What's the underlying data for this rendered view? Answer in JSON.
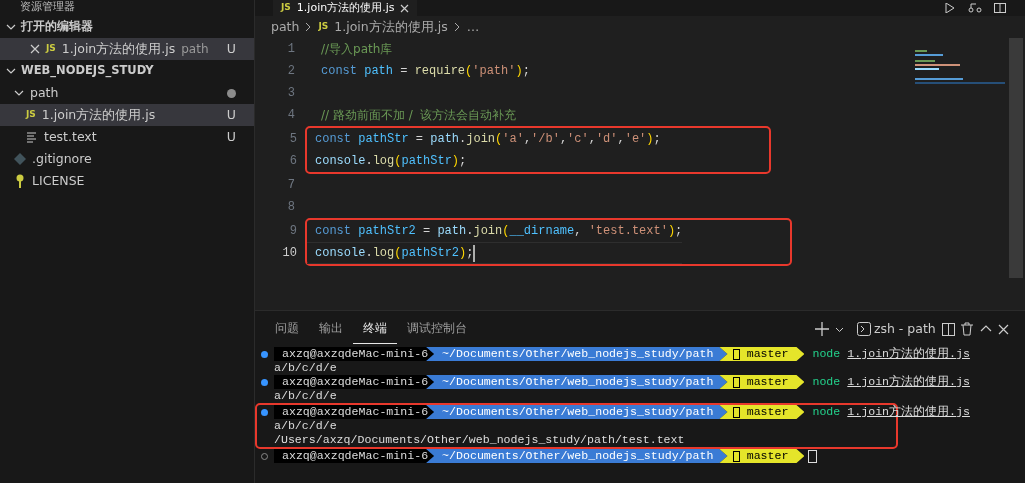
{
  "sidebar": {
    "title": "资源管理器",
    "sections": [
      {
        "title": "打开的编辑器",
        "expanded": true,
        "items": [
          {
            "kind": "js",
            "badge": "JS",
            "name": "1.join方法的使用.js",
            "folder": "path",
            "status": "U",
            "selected": true
          }
        ]
      },
      {
        "title": "WEB_NODEJS_STUDY",
        "expanded": true,
        "tree": [
          {
            "kind": "folder",
            "name": "path",
            "expanded": true,
            "modified_dot": true,
            "selected": false,
            "children": [
              {
                "kind": "js",
                "badge": "JS",
                "name": "1.join方法的使用.js",
                "status": "U",
                "selected": true
              },
              {
                "kind": "text",
                "name": "test.text",
                "status": "U",
                "selected": false
              }
            ]
          },
          {
            "kind": "git",
            "name": ".gitignore",
            "selected": false
          },
          {
            "kind": "license",
            "name": "LICENSE",
            "selected": false
          }
        ]
      }
    ]
  },
  "editor": {
    "tab": {
      "badge": "JS",
      "name": "1.join方法的使用.js"
    },
    "breadcrumbs": [
      {
        "text": "path"
      },
      {
        "badge": "JS",
        "text": "1.join方法的使用.js"
      },
      {
        "text": "…"
      }
    ],
    "blocks": [
      {
        "highlighted": false,
        "lines": [
          {
            "number": "1",
            "current": false,
            "tokens": [
              {
                "kind": "comment",
                "text": "//导入path库"
              }
            ]
          },
          {
            "number": "2",
            "current": false,
            "tokens": [
              {
                "kind": "keyword",
                "text": "const"
              },
              {
                "kind": "var",
                "text": "path"
              },
              {
                "kind": "plain",
                "text": " = "
              },
              {
                "kind": "func",
                "text": "require"
              },
              {
                "kind": "bracket",
                "text": "("
              },
              {
                "kind": "string",
                "text": "'path'"
              },
              {
                "kind": "bracket",
                "text": ")"
              },
              {
                "kind": "plain",
                "text": ";"
              }
            ]
          },
          {
            "number": "3",
            "current": false
          },
          {
            "number": "4",
            "current": false,
            "tokens": [
              {
                "kind": "comment",
                "text": "// 路劲前面不加 /  该方法会自动补充"
              }
            ]
          }
        ]
      },
      {
        "highlighted": true,
        "lines": [
          {
            "number": "5",
            "current": false,
            "tokens": [
              {
                "kind": "keyword",
                "text": "const"
              },
              {
                "kind": "var",
                "text": "pathStr"
              },
              {
                "kind": "plain",
                "text": " = "
              },
              {
                "kind": "plainvar",
                "text": "path"
              },
              {
                "kind": "plain",
                "text": "."
              },
              {
                "kind": "func",
                "text": "join"
              },
              {
                "kind": "bracket",
                "text": "("
              },
              {
                "kind": "string",
                "text": "'a'"
              },
              {
                "kind": "plain",
                "text": ","
              },
              {
                "kind": "string",
                "text": "'/b'"
              },
              {
                "kind": "plain",
                "text": ","
              },
              {
                "kind": "string",
                "text": "'c'"
              },
              {
                "kind": "plain",
                "text": ","
              },
              {
                "kind": "string",
                "text": "'d'"
              },
              {
                "kind": "plain",
                "text": ","
              },
              {
                "kind": "string",
                "text": "'e'"
              },
              {
                "kind": "bracket",
                "text": ")"
              },
              {
                "kind": "plain",
                "text": ";"
              }
            ]
          },
          {
            "number": "6",
            "current": false,
            "tokens": [
              {
                "kind": "plainvar",
                "text": "console"
              },
              {
                "kind": "plain",
                "text": "."
              },
              {
                "kind": "func",
                "text": "log"
              },
              {
                "kind": "bracket",
                "text": "("
              },
              {
                "kind": "var",
                "text": "pathStr"
              },
              {
                "kind": "bracket",
                "text": ")"
              },
              {
                "kind": "plain",
                "text": ";"
              }
            ]
          }
        ]
      },
      {
        "highlighted": false,
        "lines": [
          {
            "number": "7",
            "current": false
          },
          {
            "number": "8",
            "current": false
          }
        ]
      },
      {
        "highlighted": true,
        "lines": [
          {
            "number": "9",
            "current": false,
            "tokens": [
              {
                "kind": "keyword",
                "text": "const"
              },
              {
                "kind": "var",
                "text": "pathStr2"
              },
              {
                "kind": "plain",
                "text": " = "
              },
              {
                "kind": "plainvar",
                "text": "path"
              },
              {
                "kind": "plain",
                "text": "."
              },
              {
                "kind": "func",
                "text": "join"
              },
              {
                "kind": "bracket",
                "text": "("
              },
              {
                "kind": "var",
                "text": "__dirname"
              },
              {
                "kind": "plain",
                "text": ", "
              },
              {
                "kind": "string",
                "text": "'test.text'"
              },
              {
                "kind": "bracket",
                "text": ")"
              },
              {
                "kind": "plain",
                "text": ";"
              }
            ]
          },
          {
            "number": "10",
            "current": true,
            "tokens": [
              {
                "kind": "plainvar",
                "text": "console"
              },
              {
                "kind": "plain",
                "text": "."
              },
              {
                "kind": "func",
                "text": "log"
              },
              {
                "kind": "bracket",
                "text": "("
              },
              {
                "kind": "var",
                "text": "pathStr2"
              },
              {
                "kind": "bracket",
                "text": ")"
              },
              {
                "kind": "plain",
                "text": ";"
              }
            ]
          }
        ]
      }
    ]
  },
  "panel": {
    "tabs": [
      {
        "label": "问题",
        "selected": false
      },
      {
        "label": "输出",
        "selected": false
      },
      {
        "label": "终端",
        "selected": true
      },
      {
        "label": "调试控制台",
        "selected": false
      }
    ],
    "terminal_name": "zsh - path",
    "groups": [
      {
        "highlighted": false,
        "lines": [
          {
            "kind": "prompt",
            "done": true,
            "user": "axzq@axzqdeMac-mini-6",
            "path": "~/Documents/Other/web_nodejs_study/path",
            "branch": "master",
            "command": "node",
            "argument": "1.join方法的使用.js"
          },
          {
            "kind": "output",
            "text": "a/b/c/d/e"
          },
          {
            "kind": "prompt",
            "done": true,
            "user": "axzq@axzqdeMac-mini-6",
            "path": "~/Documents/Other/web_nodejs_study/path",
            "branch": "master",
            "command": "node",
            "argument": "1.join方法的使用.js"
          },
          {
            "kind": "output",
            "text": "a/b/c/d/e"
          }
        ]
      },
      {
        "highlighted": true,
        "lines": [
          {
            "kind": "prompt",
            "done": true,
            "user": "axzq@axzqdeMac-mini-6",
            "path": "~/Documents/Other/web_nodejs_study/path",
            "branch": "master",
            "command": "node",
            "argument": "1.join方法的使用.js"
          },
          {
            "kind": "output",
            "text": "a/b/c/d/e"
          },
          {
            "kind": "output",
            "text": "/Users/axzq/Documents/Other/web_nodejs_study/path/test.text"
          }
        ]
      },
      {
        "highlighted": false,
        "lines": [
          {
            "kind": "prompt",
            "done": false,
            "user": "axzq@axzqdeMac-mini-6",
            "path": "~/Documents/Other/web_nodejs_study/path",
            "branch": "master"
          }
        ]
      }
    ]
  }
}
